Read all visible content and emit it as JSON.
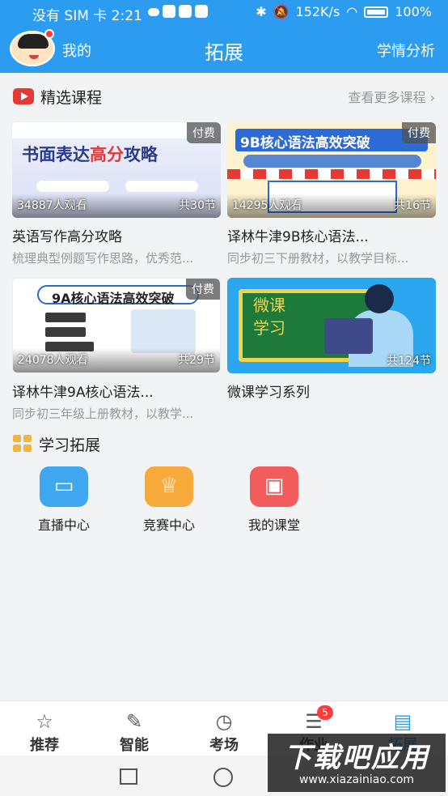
{
  "status_bar": {
    "carrier_time": "没有 SIM 卡 2:21",
    "speed": "152K/s",
    "battery": "100%"
  },
  "header": {
    "mine_label": "我的",
    "title": "拓展",
    "analysis_label": "学情分析"
  },
  "featured": {
    "title": "精选课程",
    "more_label": "查看更多课程 ›",
    "courses": [
      {
        "thumb_text_1": "书面表达",
        "thumb_text_2": "高分",
        "thumb_text_3": "攻略",
        "views": "34887人观看",
        "lessons": "共30节",
        "badge": "付费",
        "title": "英语写作高分攻略",
        "desc": "梳理典型例题写作思路，优秀范..."
      },
      {
        "thumb_text": "9B核心语法高效突破",
        "views": "14295人观看",
        "lessons": "共16节",
        "badge": "付费",
        "title": "译林牛津9B核心语法...",
        "desc": "同步初三下册教材，以教学目标..."
      },
      {
        "thumb_text": "9A核心语法高效突破",
        "views": "24078人观看",
        "lessons": "共29节",
        "badge": "付费",
        "title": "译林牛津9A核心语法...",
        "desc": "同步初三年级上册教材，以教学..."
      },
      {
        "thumb_text": "微课\n学习",
        "lessons": "共124节",
        "title": "微课学习系列"
      }
    ]
  },
  "extension": {
    "title": "学习拓展",
    "items": [
      {
        "label": "直播中心",
        "icon": "video-camera-icon"
      },
      {
        "label": "竞赛中心",
        "icon": "trophy-icon"
      },
      {
        "label": "我的课堂",
        "icon": "classroom-icon"
      }
    ]
  },
  "tabbar": {
    "items": [
      {
        "label": "推荐",
        "icon": "star-icon"
      },
      {
        "label": "智能",
        "icon": "pen-icon"
      },
      {
        "label": "考场",
        "icon": "clock-icon"
      },
      {
        "label": "作业",
        "icon": "document-icon",
        "badge": "5"
      },
      {
        "label": "拓展",
        "icon": "extension-icon",
        "active": true
      }
    ]
  },
  "watermark": {
    "main": "下载吧应用",
    "url": "www.xiazainiao.com"
  },
  "colors": {
    "primary": "#2c9cf0",
    "danger": "#e53935"
  }
}
